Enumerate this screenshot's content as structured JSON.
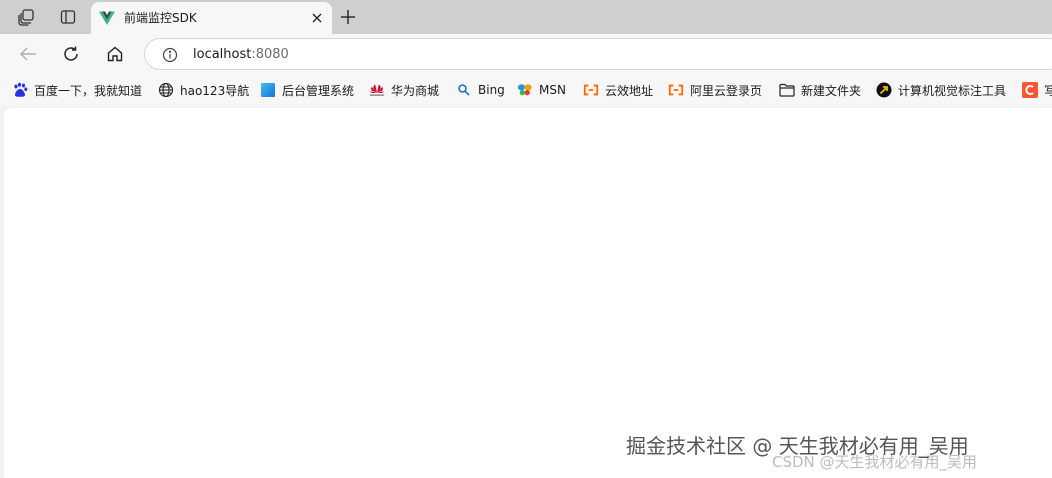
{
  "tab": {
    "title": "前端监控SDK",
    "favicon": "vue-icon"
  },
  "toolbar": {
    "url_host": "localhost",
    "url_port": ":8080"
  },
  "bookmarks": [
    {
      "label": "百度一下，我就知道",
      "icon": "baidu-paw-icon"
    },
    {
      "label": "hao123导航",
      "icon": "globe-icon"
    },
    {
      "label": "后台管理系统",
      "icon": "blue-square-icon"
    },
    {
      "label": "华为商城",
      "icon": "huawei-icon"
    },
    {
      "label": "Bing",
      "icon": "bing-search-icon"
    },
    {
      "label": "MSN",
      "icon": "msn-butterfly-icon"
    },
    {
      "label": "云效地址",
      "icon": "aliyun-icon"
    },
    {
      "label": "阿里云登录页",
      "icon": "aliyun-icon"
    },
    {
      "label": "新建文件夹",
      "icon": "folder-icon"
    },
    {
      "label": "计算机视觉标注工具",
      "icon": "arrow-circle-icon"
    },
    {
      "label": "写",
      "icon": "csdn-icon"
    }
  ],
  "watermark": {
    "text": "掘金技术社区 @ 天生我材必有用_吴用",
    "secondary": "CSDN @天生我材必有用_吴用"
  },
  "colors": {
    "tabstrip": "#cfcfcf",
    "toolbar": "#f7f7f7",
    "vue_green": "#41b883",
    "vue_dark": "#35495e",
    "aliyun_orange": "#ff6a00",
    "baidu_blue": "#2932e1",
    "huawei_red": "#cf0a2c",
    "csdn_orange": "#fc5531"
  }
}
